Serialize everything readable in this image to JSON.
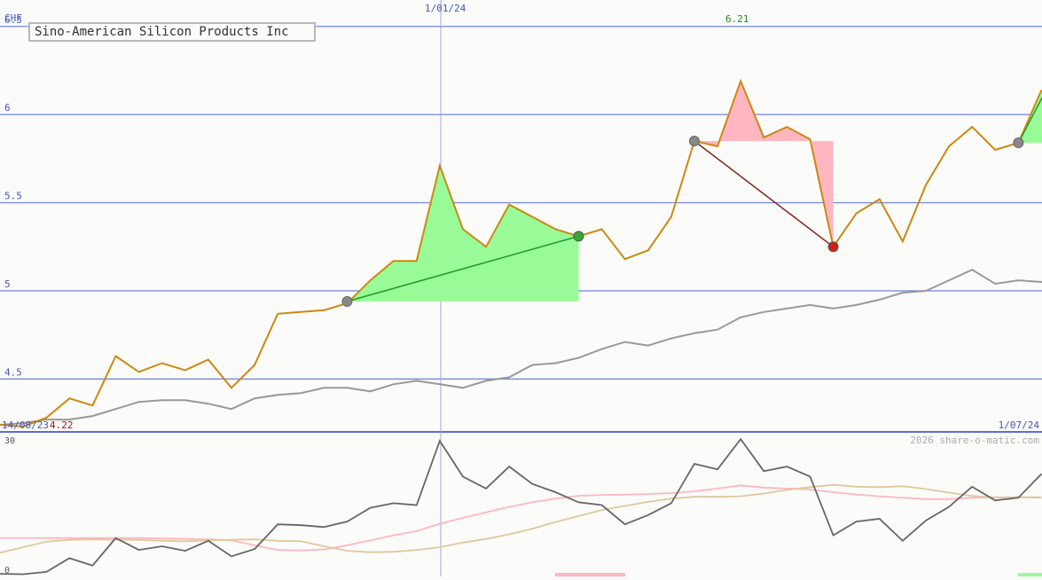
{
  "chart_data": [
    {
      "type": "line",
      "title": "Sino-American Silicon Products Inc",
      "currency": "CHF",
      "ylim": [
        4.2,
        6.65
      ],
      "yticks": [
        "6.5",
        "6",
        "5.5",
        "5",
        "4.5"
      ],
      "x_markers": [
        "1/01/24"
      ],
      "range_start": "14/08/23",
      "range_end": "1/07/24",
      "low_label": "4.22",
      "high_label": "6.21",
      "watermark": "2026 share-o-matic.com",
      "series": [
        {
          "values": [
            4.24,
            4.23,
            4.28,
            4.39,
            4.35,
            4.63,
            4.54,
            4.59,
            4.55,
            4.61,
            4.45,
            4.58,
            4.87,
            4.88,
            4.89,
            4.93,
            5.06,
            5.17,
            5.17,
            5.71,
            5.35,
            5.25,
            5.49,
            5.42,
            5.35,
            5.31,
            5.35,
            5.18,
            5.23,
            5.42,
            5.85,
            5.82,
            6.19,
            5.87,
            5.93,
            5.86,
            5.25,
            5.44,
            5.52,
            5.28,
            5.6,
            5.82,
            5.93,
            5.8,
            5.84,
            6.14
          ],
          "color": "#cc8811"
        },
        {
          "values": [
            4.24,
            4.25,
            4.27,
            4.27,
            4.29,
            4.33,
            4.37,
            4.38,
            4.38,
            4.36,
            4.33,
            4.39,
            4.41,
            4.42,
            4.45,
            4.45,
            4.43,
            4.47,
            4.49,
            4.47,
            4.45,
            4.49,
            4.51,
            4.58,
            4.59,
            4.62,
            4.67,
            4.71,
            4.69,
            4.73,
            4.76,
            4.78,
            4.85,
            4.88,
            4.9,
            4.92,
            4.9,
            4.92,
            4.95,
            4.99,
            5.0,
            5.06,
            5.12,
            5.04,
            5.06,
            5.05,
            5.13
          ],
          "color": "#999999"
        }
      ],
      "trades": [
        {
          "from": {
            "x": 15,
            "y": 4.94
          },
          "to": {
            "x": 25,
            "y": 5.31
          },
          "result": "gain"
        },
        {
          "from": {
            "x": 30,
            "y": 5.85
          },
          "to": {
            "x": 36,
            "y": 5.25
          },
          "result": "loss"
        },
        {
          "from": {
            "x": 44,
            "y": 5.84
          },
          "to": {
            "x": 45.2,
            "y": 6.14
          },
          "result": "gain"
        }
      ],
      "colors": {
        "gain": "#98fb98",
        "loss": "#ffb6c1",
        "grid": "#7b8fe0"
      }
    },
    {
      "type": "line",
      "ylim": [
        0,
        30
      ],
      "yticks": [
        "30",
        "0"
      ],
      "series": [
        {
          "values": [
            0.2,
            0.1,
            0.6,
            3.6,
            2.0,
            8.0,
            5.4,
            6.2,
            5.2,
            7.4,
            4.0,
            5.6,
            11.0,
            10.8,
            10.4,
            11.6,
            14.6,
            15.6,
            15.2,
            29.2,
            21.4,
            18.8,
            23.6,
            19.8,
            18.0,
            15.8,
            15.2,
            11.0,
            13.0,
            15.6,
            24.2,
            23.0,
            29.6,
            22.6,
            23.6,
            21.4,
            8.6,
            11.6,
            12.2,
            7.4,
            11.8,
            14.8,
            19.2,
            16.2,
            16.8,
            22.0
          ],
          "color": "#666666"
        },
        {
          "values": [
            8.0,
            8.0,
            8.0,
            8.0,
            8.0,
            8.0,
            8.0,
            7.9,
            7.8,
            7.7,
            7.5,
            6.4,
            5.4,
            5.3,
            5.5,
            6.4,
            7.5,
            8.6,
            9.5,
            11.1,
            12.4,
            13.6,
            14.8,
            15.8,
            16.6,
            17.2,
            17.4,
            17.5,
            17.6,
            17.8,
            18.2,
            18.8,
            19.5,
            19.0,
            18.8,
            18.6,
            18.0,
            17.5,
            17.1,
            16.8,
            16.5,
            16.5,
            16.8,
            16.9,
            16.9,
            16.9
          ],
          "color": "#ffb6c1"
        },
        {
          "values": [
            4.8,
            6.0,
            7.2,
            7.6,
            7.7,
            7.6,
            7.6,
            7.4,
            7.3,
            7.5,
            7.6,
            7.7,
            7.4,
            7.3,
            6.2,
            5.2,
            4.9,
            5.0,
            5.4,
            6.0,
            7.0,
            7.8,
            8.8,
            10.0,
            11.5,
            12.8,
            14.1,
            15.0,
            15.9,
            16.6,
            17.0,
            17.0,
            17.1,
            17.7,
            18.5,
            19.1,
            19.6,
            19.2,
            19.1,
            19.3,
            18.7,
            17.9,
            17.2,
            16.8,
            16.9,
            16.8
          ],
          "color": "#e0c89c"
        }
      ]
    }
  ]
}
